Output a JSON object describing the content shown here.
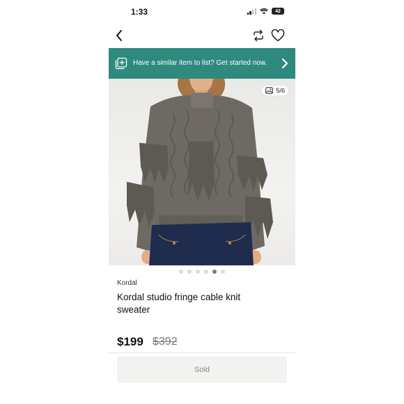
{
  "status_bar": {
    "time": "1:33",
    "battery": "42"
  },
  "nav": {
    "back_icon": "chevron-left-icon",
    "repost_icon": "repost-icon",
    "like_icon": "heart-icon"
  },
  "banner": {
    "text": "Have a similar item to list? Get started now.",
    "icon": "photo-add-icon",
    "chevron": "chevron-right-icon",
    "color": "#2e8a7e"
  },
  "gallery": {
    "counter": "5/6",
    "total": 6,
    "active_index": 4
  },
  "product": {
    "brand": "Kordal",
    "title": "Kordal studio fringe cable knit sweater",
    "price": "$199",
    "original_price": "$392"
  },
  "action": {
    "label": "Sold"
  }
}
